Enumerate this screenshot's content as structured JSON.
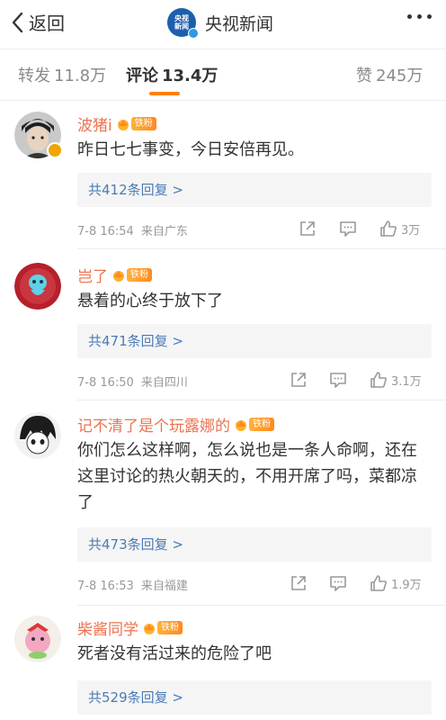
{
  "header": {
    "back_label": "返回",
    "logo_text": "央视新闻",
    "channel_name": "央视新闻"
  },
  "tabs": {
    "repost": {
      "label": "转发",
      "count": "11.8万"
    },
    "comments": {
      "label": "评论",
      "count": "13.4万"
    },
    "likes": {
      "label": "赞",
      "count": "245万"
    }
  },
  "accent_color": "#ff8200",
  "comments": [
    {
      "username": "波猪i",
      "fan_badge": "铁粉",
      "text": "昨日七七事变，今日安倍再见。",
      "reply_summary": "共412条回复 >",
      "time": "7-8 16:54",
      "location": "来自广东",
      "likes": "3万"
    },
    {
      "username": "岂了",
      "fan_badge": "铁粉",
      "text": "悬着的心终于放下了",
      "reply_summary": "共471条回复 >",
      "time": "7-8 16:50",
      "location": "来自四川",
      "likes": "3.1万"
    },
    {
      "username": "记不清了是个玩露娜的",
      "fan_badge": "铁粉",
      "text": "你们怎么这样啊，怎么说也是一条人命啊，还在这里讨论的热火朝天的，不用开席了吗，菜都凉了",
      "reply_summary": "共473条回复 >",
      "time": "7-8 16:53",
      "location": "来自福建",
      "likes": "1.9万"
    },
    {
      "username": "柴酱同学",
      "fan_badge": "铁粉",
      "text": "死者没有活过来的危险了吧",
      "reply_summary": "共529条回复 >",
      "time": "",
      "location": "",
      "likes": ""
    }
  ]
}
